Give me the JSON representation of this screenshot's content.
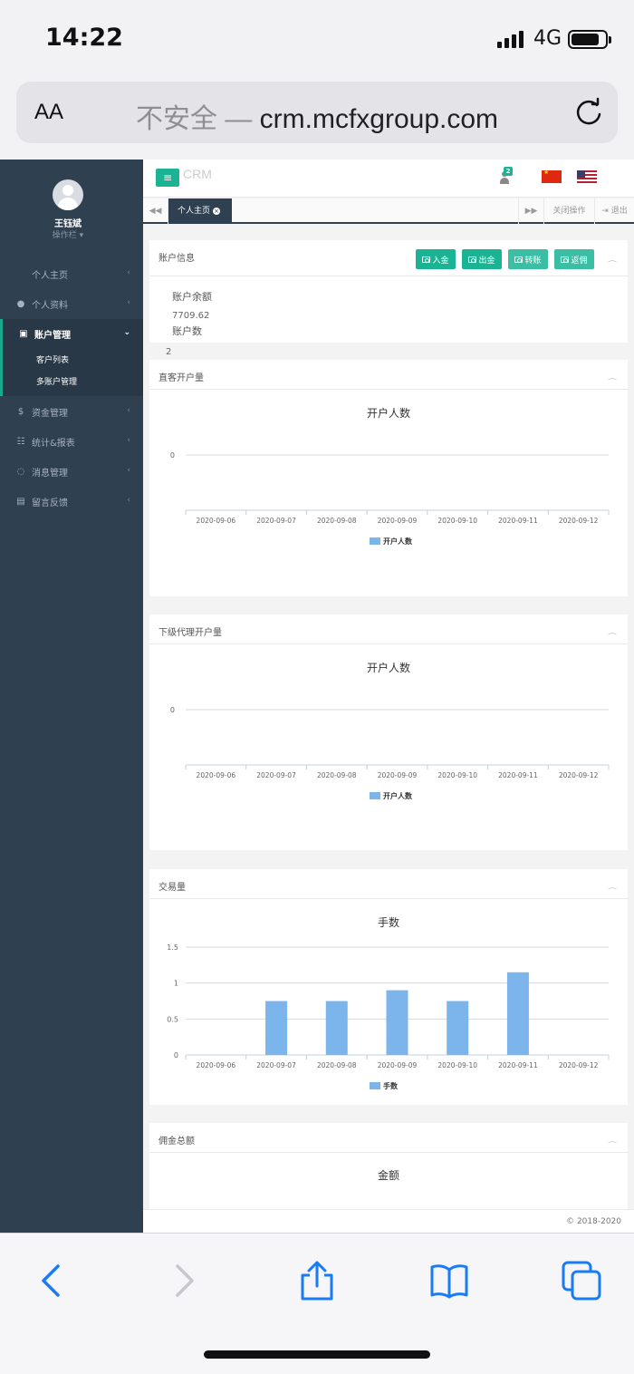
{
  "status": {
    "time": "14:22",
    "network": "4G"
  },
  "browser": {
    "aa_label": "AA",
    "insecure_label": "不安全 —",
    "domain": "crm.mcfxgroup.com"
  },
  "sidebar": {
    "user_name": "王钰斌",
    "user_role": "操作栏 ▾",
    "items": [
      {
        "icon": "",
        "label": "个人主页"
      },
      {
        "icon": "user-icon",
        "label": "个人资料"
      },
      {
        "icon": "id-card-icon",
        "label": "账户管理"
      },
      {
        "icon": "dollar-icon",
        "label": "资金管理"
      },
      {
        "icon": "table-icon",
        "label": "统计&报表"
      },
      {
        "icon": "chat-icon",
        "label": "消息管理"
      },
      {
        "icon": "feedback-icon",
        "label": "留言反馈"
      }
    ],
    "sub_items": [
      "客户列表",
      "多账户管理"
    ]
  },
  "header": {
    "brand": "CRM",
    "notification_count": "2"
  },
  "tabs": {
    "active": "个人主页",
    "close_ops": "关闭操作",
    "logout": "退出"
  },
  "account_panel": {
    "title": "账户信息",
    "buttons": [
      "入金",
      "出金",
      "转账",
      "返佣"
    ],
    "balance_label": "账户余额",
    "balance_value": "7709.62",
    "count_label": "账户数",
    "count_value": "2"
  },
  "panels": {
    "direct_title": "直客开户量",
    "agent_title": "下级代理开户量",
    "volume_title": "交易量",
    "commission_title": "佣金总额",
    "commission_chart_title": "金额"
  },
  "chart_data": [
    {
      "type": "bar",
      "title": "开户人数",
      "categories": [
        "2020-09-06",
        "2020-09-07",
        "2020-09-08",
        "2020-09-09",
        "2020-09-10",
        "2020-09-11",
        "2020-09-12"
      ],
      "series": [
        {
          "name": "开户人数",
          "values": [
            0,
            0,
            0,
            0,
            0,
            0,
            0
          ]
        }
      ],
      "yticks": [
        "0"
      ],
      "color": "#7cb5ec"
    },
    {
      "type": "bar",
      "title": "开户人数",
      "categories": [
        "2020-09-06",
        "2020-09-07",
        "2020-09-08",
        "2020-09-09",
        "2020-09-10",
        "2020-09-11",
        "2020-09-12"
      ],
      "series": [
        {
          "name": "开户人数",
          "values": [
            0,
            0,
            0,
            0,
            0,
            0,
            0
          ]
        }
      ],
      "yticks": [
        "0"
      ],
      "color": "#7cb5ec"
    },
    {
      "type": "bar",
      "title": "手数",
      "categories": [
        "2020-09-06",
        "2020-09-07",
        "2020-09-08",
        "2020-09-09",
        "2020-09-10",
        "2020-09-11",
        "2020-09-12"
      ],
      "series": [
        {
          "name": "手数",
          "values": [
            0,
            0.75,
            0.75,
            0.9,
            0.75,
            1.15,
            0
          ]
        }
      ],
      "yticks": [
        "0",
        "0.5",
        "1",
        "1.5"
      ],
      "ylim": [
        0,
        1.5
      ],
      "color": "#7cb5ec"
    }
  ],
  "footer": {
    "copyright": "© 2018-2020"
  },
  "colors": {
    "accent": "#1ab394",
    "sidebar": "#2f4050",
    "bar": "#7cb5ec"
  }
}
